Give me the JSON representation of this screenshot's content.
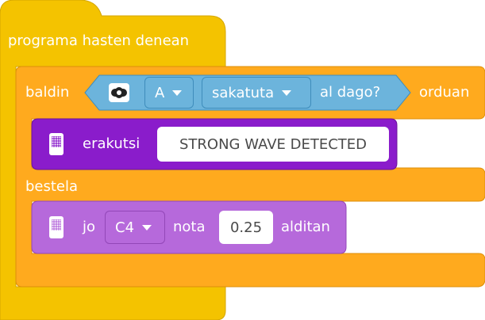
{
  "colors": {
    "event_yellow": "#F4C300",
    "event_yellow_border": "#D4A600",
    "control_orange": "#FFAA1E",
    "control_orange_border": "#DE8F0B",
    "sensor_blue": "#6CB4DC",
    "sensor_blue_border": "#3F8DBC",
    "display_purple": "#8A1CCB",
    "display_purple_border": "#6A1299",
    "sound_purple": "#B669DB",
    "sound_purple_border": "#9347B8"
  },
  "hat_block": {
    "label": "programa hasten denean"
  },
  "if_block": {
    "if_label": "baldin",
    "then_label": "orduan",
    "else_label": "bestela",
    "condition": {
      "icon": "color-sensor-icon",
      "port": "A",
      "state": "sakatuta",
      "suffix": "al dago?"
    }
  },
  "write_block": {
    "icon": "hub-display-icon",
    "label": "erakutsi",
    "value": "STRONG WAVE DETECTED"
  },
  "sound_block": {
    "icon": "hub-speaker-icon",
    "label_play": "jo",
    "note": "C4",
    "label_note": "nota",
    "duration": "0.25",
    "label_beats": "alditan"
  }
}
